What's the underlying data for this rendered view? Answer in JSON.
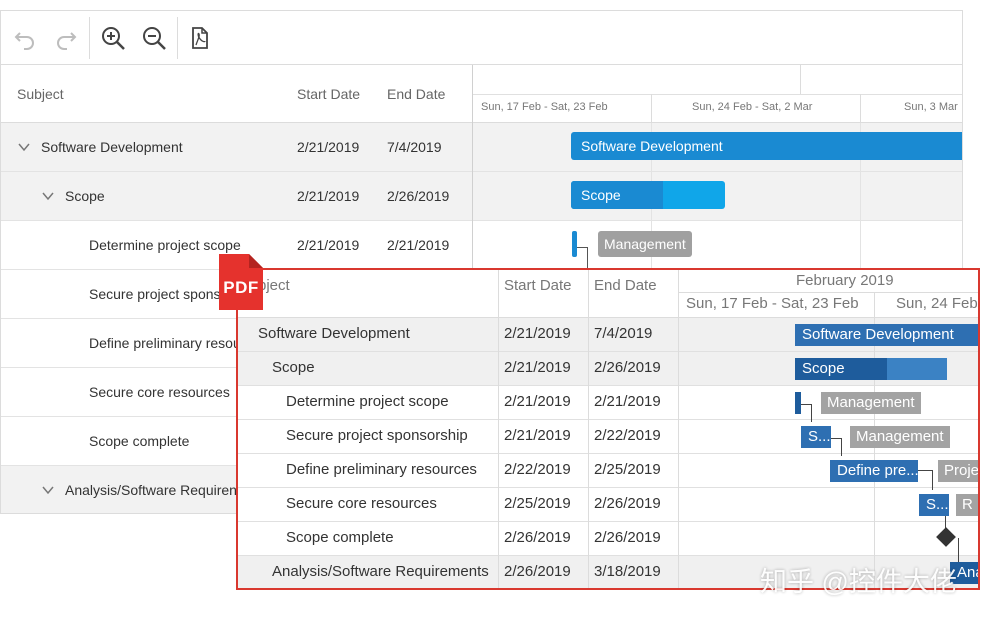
{
  "colors": {
    "bar_blue": "#1a8ad2",
    "bar_blue_light": "#10a6e9",
    "bar_gray": "#a0a0a0",
    "pdf_border": "#d9382f",
    "pdf_bar_blue": "#2e6fb2",
    "pdf_bar_blue_dark": "#1e5c9c"
  },
  "toolbar": {
    "icons": [
      "undo-icon",
      "redo-icon",
      "zoom-in-icon",
      "zoom-out-icon",
      "pdf-export-icon"
    ]
  },
  "grid": {
    "columns": {
      "subject": "Subject",
      "start": "Start Date",
      "end": "End Date"
    },
    "rows": [
      {
        "subject": "Software Development",
        "start": "2/21/2019",
        "end": "7/4/2019"
      },
      {
        "subject": "Scope",
        "start": "2/21/2019",
        "end": "2/26/2019"
      },
      {
        "subject": "Determine project scope",
        "start": "2/21/2019",
        "end": "2/21/2019"
      },
      {
        "subject": "Secure project spons",
        "start": "",
        "end": ""
      },
      {
        "subject": "Define preliminary resou",
        "start": "",
        "end": ""
      },
      {
        "subject": "Secure core resources",
        "start": "",
        "end": ""
      },
      {
        "subject": "Scope complete",
        "start": "",
        "end": ""
      },
      {
        "subject": "Analysis/Software Requiren",
        "start": "",
        "end": ""
      }
    ]
  },
  "timeline": {
    "weeks": [
      "Sun, 17 Feb - Sat, 23 Feb",
      "Sun, 24 Feb - Sat, 2 Mar",
      "Sun, 3 Mar"
    ],
    "bars": {
      "software_development": "Software Development",
      "scope": "Scope",
      "scope_progress": 0.6,
      "management": "Management"
    }
  },
  "pdf": {
    "badge": "PDF",
    "columns": {
      "subject": "bject",
      "start": "Start Date",
      "end": "End Date"
    },
    "month": "February 2019",
    "weeks": [
      "Sun, 17 Feb - Sat, 23 Feb",
      "Sun, 24 Feb"
    ],
    "rows": [
      {
        "subject": "Software Development",
        "start": "2/21/2019",
        "end": "7/4/2019"
      },
      {
        "subject": "Scope",
        "start": "2/21/2019",
        "end": "2/26/2019"
      },
      {
        "subject": "Determine project scope",
        "start": "2/21/2019",
        "end": "2/21/2019"
      },
      {
        "subject": "Secure project sponsorship",
        "start": "2/21/2019",
        "end": "2/22/2019"
      },
      {
        "subject": "Define preliminary resources",
        "start": "2/22/2019",
        "end": "2/25/2019"
      },
      {
        "subject": "Secure core resources",
        "start": "2/25/2019",
        "end": "2/26/2019"
      },
      {
        "subject": "Scope complete",
        "start": "2/26/2019",
        "end": "2/26/2019"
      },
      {
        "subject": "Analysis/Software Requirements",
        "start": "2/26/2019",
        "end": "3/18/2019"
      }
    ],
    "bars": {
      "software_development": "Software Development",
      "scope": "Scope",
      "management_1": "Management",
      "secure_short": "S...",
      "management_2": "Management",
      "define_short": "Define pre...",
      "proje": "Proje",
      "secure_core_short": "S...",
      "small_r": "R",
      "analysis_short": "Ana"
    }
  },
  "watermark": "知乎 @控件大佬"
}
